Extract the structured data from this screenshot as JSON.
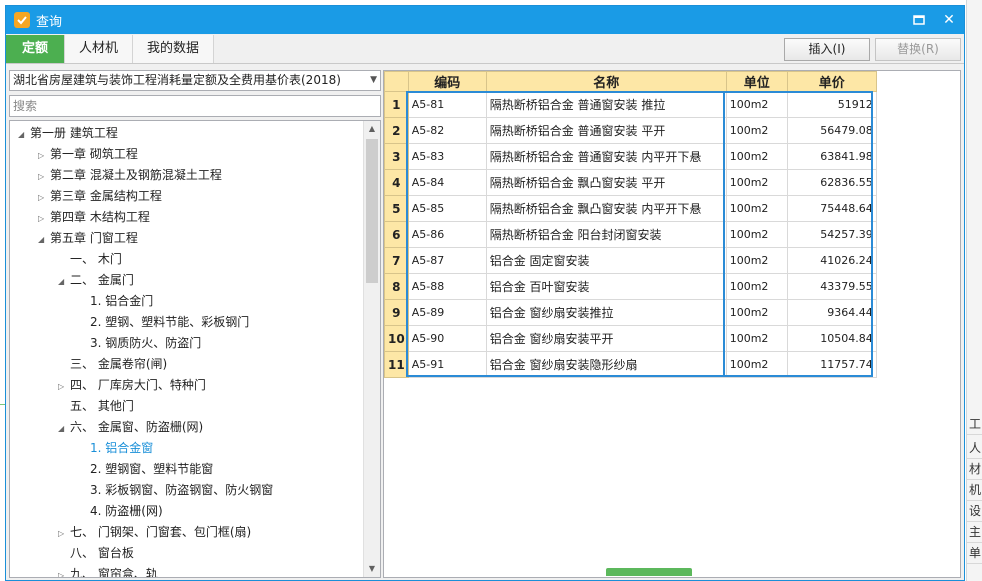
{
  "window": {
    "title": "查询"
  },
  "tabs": [
    {
      "label": "定额",
      "active": true
    },
    {
      "label": "人材机",
      "active": false
    },
    {
      "label": "我的数据",
      "active": false
    }
  ],
  "toolbar": {
    "insert_label": "插入(I)",
    "replace_label": "替换(R)"
  },
  "left": {
    "quota_book": "湖北省房屋建筑与装饰工程消耗量定额及全费用基价表(2018)",
    "search_placeholder": "搜索"
  },
  "tree": [
    {
      "label": "第一册  建筑工程",
      "toggle": "◢",
      "indent": 0
    },
    {
      "label": "第一章  砌筑工程",
      "toggle": "▷",
      "indent": 1
    },
    {
      "label": "第二章  混凝土及钢筋混凝土工程",
      "toggle": "▷",
      "indent": 1
    },
    {
      "label": "第三章  金属结构工程",
      "toggle": "▷",
      "indent": 1
    },
    {
      "label": "第四章  木结构工程",
      "toggle": "▷",
      "indent": 1
    },
    {
      "label": "第五章  门窗工程",
      "toggle": "◢",
      "indent": 1
    },
    {
      "label": "一、  木门",
      "toggle": "",
      "indent": 2
    },
    {
      "label": "二、  金属门",
      "toggle": "◢",
      "indent": 2
    },
    {
      "label": "1.  铝合金门",
      "toggle": "",
      "indent": 3
    },
    {
      "label": "2.  塑钢、塑料节能、彩板钢门",
      "toggle": "",
      "indent": 3
    },
    {
      "label": "3.  钢质防火、防盗门",
      "toggle": "",
      "indent": 3
    },
    {
      "label": "三、  金属卷帘(闸)",
      "toggle": "",
      "indent": 2
    },
    {
      "label": "四、  厂库房大门、特种门",
      "toggle": "▷",
      "indent": 2
    },
    {
      "label": "五、  其他门",
      "toggle": "",
      "indent": 2
    },
    {
      "label": "六、  金属窗、防盗栅(网)",
      "toggle": "◢",
      "indent": 2
    },
    {
      "label": "1.  铝合金窗",
      "toggle": "",
      "indent": 3,
      "selected": true
    },
    {
      "label": "2.  塑钢窗、塑料节能窗",
      "toggle": "",
      "indent": 3
    },
    {
      "label": "3.  彩板钢窗、防盗钢窗、防火钢窗",
      "toggle": "",
      "indent": 3
    },
    {
      "label": "4.  防盗栅(网)",
      "toggle": "",
      "indent": 3
    },
    {
      "label": "七、  门钢架、门窗套、包门框(扇)",
      "toggle": "▷",
      "indent": 2
    },
    {
      "label": "八、  窗台板",
      "toggle": "",
      "indent": 2
    },
    {
      "label": "九、  窗帘盒、轨",
      "toggle": "▷",
      "indent": 2
    }
  ],
  "grid": {
    "headers": [
      "编码",
      "名称",
      "单位",
      "单价"
    ],
    "rows": [
      {
        "n": "1",
        "code": "A5-81",
        "name": "隔热断桥铝合金 普通窗安装 推拉",
        "unit": "100m2",
        "price": "51912"
      },
      {
        "n": "2",
        "code": "A5-82",
        "name": "隔热断桥铝合金 普通窗安装 平开",
        "unit": "100m2",
        "price": "56479.08"
      },
      {
        "n": "3",
        "code": "A5-83",
        "name": "隔热断桥铝合金 普通窗安装 内平开下悬",
        "unit": "100m2",
        "price": "63841.98"
      },
      {
        "n": "4",
        "code": "A5-84",
        "name": "隔热断桥铝合金 飘凸窗安装 平开",
        "unit": "100m2",
        "price": "62836.55"
      },
      {
        "n": "5",
        "code": "A5-85",
        "name": "隔热断桥铝合金 飘凸窗安装 内平开下悬",
        "unit": "100m2",
        "price": "75448.64"
      },
      {
        "n": "6",
        "code": "A5-86",
        "name": "隔热断桥铝合金 阳台封闭窗安装",
        "unit": "100m2",
        "price": "54257.39"
      },
      {
        "n": "7",
        "code": "A5-87",
        "name": "铝合金 固定窗安装",
        "unit": "100m2",
        "price": "41026.24"
      },
      {
        "n": "8",
        "code": "A5-88",
        "name": "铝合金 百叶窗安装",
        "unit": "100m2",
        "price": "43379.55"
      },
      {
        "n": "9",
        "code": "A5-89",
        "name": "铝合金 窗纱扇安装推拉",
        "unit": "100m2",
        "price": "9364.44"
      },
      {
        "n": "10",
        "code": "A5-90",
        "name": "铝合金 窗纱扇安装平开",
        "unit": "100m2",
        "price": "10504.84"
      },
      {
        "n": "11",
        "code": "A5-91",
        "name": "铝合金 窗纱扇安装隐形纱扇",
        "unit": "100m2",
        "price": "11757.74"
      }
    ]
  },
  "background_fragments": [
    "工料",
    "人",
    "材",
    "机",
    "设",
    "主",
    "单"
  ],
  "colors": {
    "titlebar": "#1a9be6",
    "active_tab": "#4caf50",
    "grid_header": "#fde7a6",
    "selection": "#2b8bd6",
    "selected_tree_text": "#1a8fd8"
  }
}
